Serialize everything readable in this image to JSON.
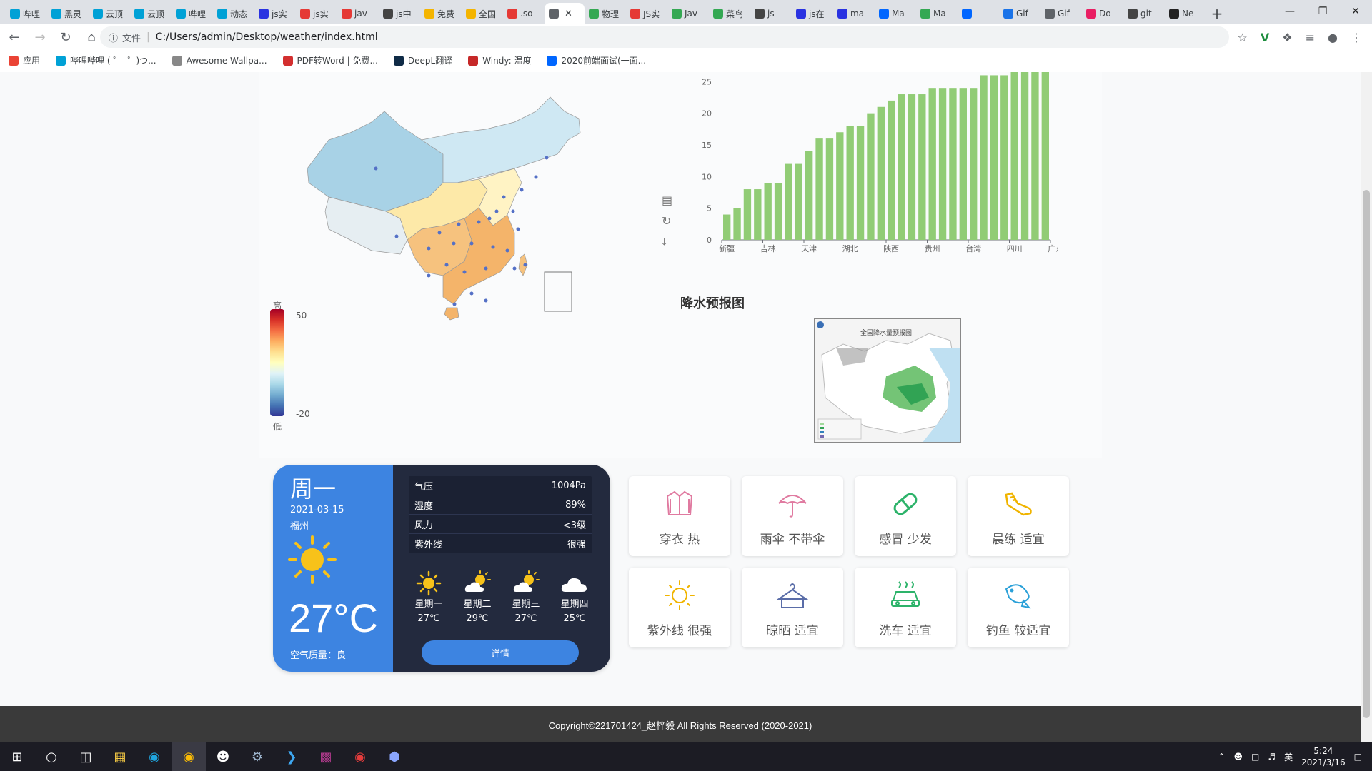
{
  "browser": {
    "tabs": [
      {
        "label": "哔哩",
        "color": "#00a1d6"
      },
      {
        "label": "黑灵",
        "color": "#00a1d6"
      },
      {
        "label": "云顶",
        "color": "#00a1d6"
      },
      {
        "label": "云顶",
        "color": "#00a1d6"
      },
      {
        "label": "哔哩",
        "color": "#00a1d6"
      },
      {
        "label": "动态",
        "color": "#00a1d6"
      },
      {
        "label": "js实",
        "color": "#2932e1"
      },
      {
        "label": "js实",
        "color": "#e53935"
      },
      {
        "label": "jav",
        "color": "#e53935"
      },
      {
        "label": "js中",
        "color": "#444444"
      },
      {
        "label": "免费",
        "color": "#f4b400"
      },
      {
        "label": "全国",
        "color": "#f4b400"
      },
      {
        "label": ".so",
        "color": "#e53935"
      },
      {
        "label": "",
        "color": "#5f6368",
        "active": true
      },
      {
        "label": "物理",
        "color": "#34a853"
      },
      {
        "label": "JS实",
        "color": "#e53935"
      },
      {
        "label": "Jav",
        "color": "#34a853"
      },
      {
        "label": "菜鸟",
        "color": "#34a853"
      },
      {
        "label": "js",
        "color": "#444444"
      },
      {
        "label": "js在",
        "color": "#2932e1"
      },
      {
        "label": "ma",
        "color": "#2932e1"
      },
      {
        "label": "Ma",
        "color": "#0066ff"
      },
      {
        "label": "Ma",
        "color": "#34a853"
      },
      {
        "label": "一",
        "color": "#0066ff"
      },
      {
        "label": "Gif",
        "color": "#1a73e8"
      },
      {
        "label": "Gif",
        "color": "#5f6368"
      },
      {
        "label": "Do",
        "color": "#e91e63"
      },
      {
        "label": "git",
        "color": "#444444"
      },
      {
        "label": "Ne",
        "color": "#222222"
      }
    ],
    "new_tab": "+",
    "window_controls": [
      "—",
      "❐",
      "✕"
    ],
    "scheme_label": "文件",
    "url": "C:/Users/admin/Desktop/weather/index.html",
    "bookmarks": [
      {
        "label": "应用",
        "color": "#ea4335"
      },
      {
        "label": "哔哩哔哩 ( ゜- ゜)つ...",
        "color": "#00a1d6"
      },
      {
        "label": "Awesome Wallpa...",
        "color": "#888888"
      },
      {
        "label": "PDF转Word | 免费...",
        "color": "#d32f2f"
      },
      {
        "label": "DeepL翻译",
        "color": "#0f2b46"
      },
      {
        "label": "Windy: 温度",
        "color": "#c62828"
      },
      {
        "label": "2020前端面试(一面...",
        "color": "#0066ff"
      }
    ]
  },
  "map": {
    "legend_high": "高",
    "legend_low": "低",
    "legend_max": "50",
    "legend_min": "-20"
  },
  "bar_chart": {
    "categories_labels": [
      "新疆",
      "吉林",
      "天津",
      "湖北",
      "陕西",
      "贵州",
      "台湾",
      "四川",
      "广东"
    ],
    "y_ticks": [
      "0",
      "5",
      "10",
      "15",
      "20",
      "25"
    ],
    "bar_color": "#91cc75"
  },
  "chart_data": {
    "type": "bar",
    "ylim": [
      0,
      26.5
    ],
    "values": [
      4,
      5,
      8,
      8,
      9,
      9,
      12,
      12,
      14,
      16,
      16,
      17,
      18,
      18,
      20,
      21,
      22,
      23,
      23,
      23,
      24,
      24,
      24,
      24,
      24,
      26,
      26,
      26,
      26.5,
      26.5,
      26.5,
      26.5
    ],
    "x_tick_labels": [
      "新疆",
      "吉林",
      "天津",
      "湖北",
      "陕西",
      "贵州",
      "台湾",
      "四川",
      "广东"
    ],
    "ylabel": "",
    "xlabel": ""
  },
  "rain": {
    "title": "降水预报图",
    "map_heading": "全国降水量预报图"
  },
  "weather": {
    "day": "周一",
    "date": "2021-03-15",
    "city": "福州",
    "temp": "27°C",
    "air_quality": "空气质量：良",
    "stats": [
      {
        "label": "气压",
        "value": "1004Pa"
      },
      {
        "label": "湿度",
        "value": "89%"
      },
      {
        "label": "风力",
        "value": "<3级"
      },
      {
        "label": "紫外线",
        "value": "很强"
      }
    ],
    "forecast": [
      {
        "day": "星期一",
        "temp": "27℃",
        "icon": "sun"
      },
      {
        "day": "星期二",
        "temp": "29℃",
        "icon": "sun-cloud"
      },
      {
        "day": "星期三",
        "temp": "27℃",
        "icon": "sun-cloud"
      },
      {
        "day": "星期四",
        "temp": "25℃",
        "icon": "cloud"
      }
    ],
    "detail_button": "详情"
  },
  "lifestyle": [
    {
      "label": "穿衣 热",
      "icon": "jacket",
      "color": "#e07aa0"
    },
    {
      "label": "雨伞 不带伞",
      "icon": "umbrella",
      "color": "#e07aa0"
    },
    {
      "label": "感冒 少发",
      "icon": "pill",
      "color": "#2db36a"
    },
    {
      "label": "晨练 适宜",
      "icon": "shoe",
      "color": "#f0b400"
    },
    {
      "label": "紫外线 很强",
      "icon": "uv-sun",
      "color": "#f0b400"
    },
    {
      "label": "晾晒 适宜",
      "icon": "hanger",
      "color": "#5a6da8"
    },
    {
      "label": "洗车 适宜",
      "icon": "car",
      "color": "#2db36a"
    },
    {
      "label": "钓鱼 较适宜",
      "icon": "fish",
      "color": "#2aa0d8"
    }
  ],
  "footer": "Copyright©221701424_赵梓毅 All Rights Reserved (2020-2021)",
  "taskbar": {
    "time": "5:24",
    "date": "2021/3/16",
    "ime": "英"
  }
}
